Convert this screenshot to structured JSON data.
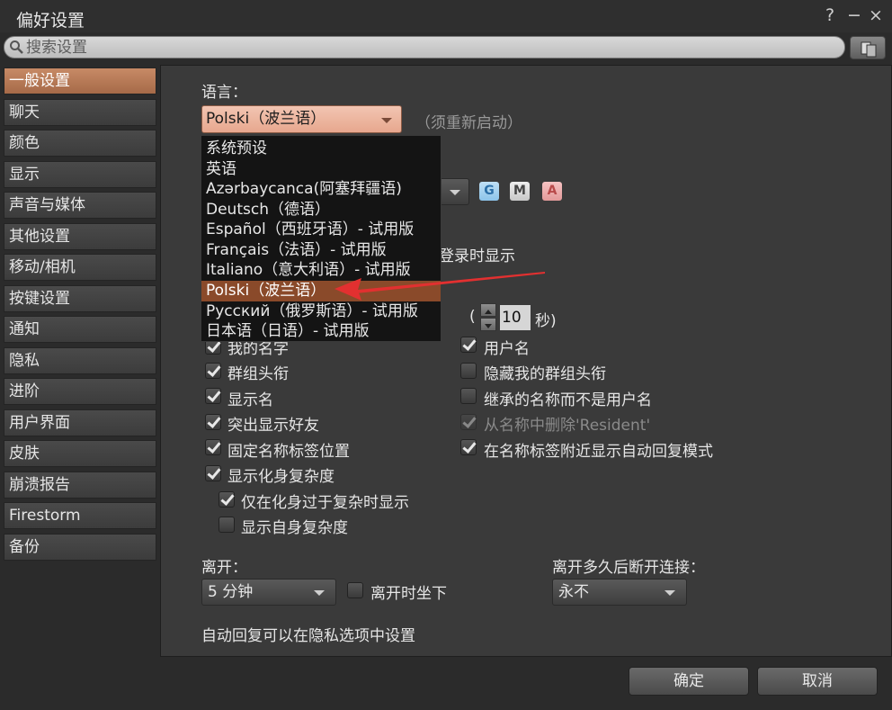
{
  "window": {
    "title": "偏好设置",
    "help": "?",
    "minimize": "−",
    "close": "×"
  },
  "search": {
    "placeholder": "搜索设置"
  },
  "sidebar": {
    "items": [
      {
        "label": "一般设置",
        "active": true
      },
      {
        "label": "聊天"
      },
      {
        "label": "颜色"
      },
      {
        "label": "显示"
      },
      {
        "label": "声音与媒体"
      },
      {
        "label": "其他设置"
      },
      {
        "label": "移动/相机"
      },
      {
        "label": "按键设置"
      },
      {
        "label": "通知"
      },
      {
        "label": "隐私"
      },
      {
        "label": "进阶"
      },
      {
        "label": "用户界面"
      },
      {
        "label": "皮肤"
      },
      {
        "label": "崩溃报告"
      },
      {
        "label": "Firestorm"
      },
      {
        "label": "备份"
      }
    ]
  },
  "general": {
    "language_label": "语言：",
    "language_value": "Polski（波兰语）",
    "restart_note": "（须重新启动）",
    "maturity_buttons": [
      "G",
      "M",
      "A"
    ],
    "show_on_login_fragment": "登录时显示",
    "paren_open": "(",
    "timeout_value": "10",
    "timeout_unit": "秒)",
    "name_tags_left": [
      {
        "label": "我的名字",
        "checked": true
      },
      {
        "label": "群组头衔",
        "checked": true
      },
      {
        "label": "显示名",
        "checked": true
      },
      {
        "label": "突出显示好友",
        "checked": true
      },
      {
        "label": "固定名称标签位置",
        "checked": true
      },
      {
        "label": "显示化身复杂度",
        "checked": true
      }
    ],
    "sub_options": [
      {
        "label": "仅在化身过于复杂时显示",
        "checked": true
      },
      {
        "label": "显示自身复杂度",
        "checked": false
      }
    ],
    "name_tags_right": [
      {
        "label": "用户名",
        "checked": true
      },
      {
        "label": "隐藏我的群组头衔",
        "checked": false
      },
      {
        "label": "继承的名称而不是用户名",
        "checked": false
      },
      {
        "label": "从名称中删除'Resident'",
        "checked": true,
        "disabled": true
      },
      {
        "label": "在名称标签附近显示自动回复模式",
        "checked": true
      }
    ],
    "away_label": "离开：",
    "away_value": "5 分钟",
    "sit_when_away": "离开时坐下",
    "disconnect_label": "离开多久后断开连接：",
    "disconnect_value": "永不",
    "autoreply_note": "自动回复可以在隐私选项中设置"
  },
  "language_dropdown": {
    "options": [
      "系统预设",
      "英语",
      "Azərbaycanca(阿塞拜疆语)",
      "Deutsch（德语）",
      "Español（西班牙语）- 试用版",
      "Français（法语）- 试用版",
      "Italiano（意大利语）- 试用版",
      "Polski（波兰语）",
      "Русский（俄罗斯语）- 试用版",
      "日本语（日语）- 试用版"
    ],
    "selected_index": 7
  },
  "footer": {
    "ok": "确定",
    "cancel": "取消"
  },
  "colors": {
    "accent": "#b8785a",
    "selected_row": "#8a4a2a",
    "arrow": "#e23030"
  }
}
